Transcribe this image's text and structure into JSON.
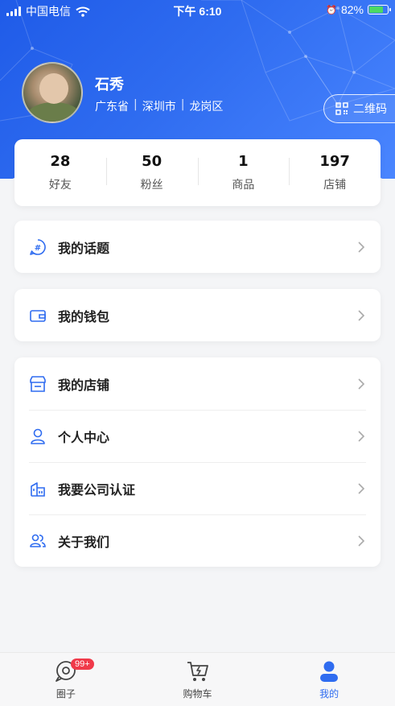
{
  "status_bar": {
    "carrier": "中国电信",
    "time": "下午 6:10",
    "battery": "82%"
  },
  "profile": {
    "name": "石秀",
    "province": "广东省",
    "city": "深圳市",
    "district": "龙岗区",
    "qr_label": "二维码"
  },
  "stats": [
    {
      "value": "28",
      "label": "好友"
    },
    {
      "value": "50",
      "label": "粉丝"
    },
    {
      "value": "1",
      "label": "商品"
    },
    {
      "value": "197",
      "label": "店铺"
    }
  ],
  "menu": {
    "topics": "我的话题",
    "wallet": "我的钱包",
    "shop": "我的店铺",
    "personal": "个人中心",
    "company": "我要公司认证",
    "about": "关于我们"
  },
  "tabbar": {
    "circle": "圈子",
    "circle_badge": "99+",
    "cart": "购物车",
    "mine": "我的"
  },
  "colors": {
    "accent": "#2f6cf0",
    "badge": "#f03a4a"
  }
}
